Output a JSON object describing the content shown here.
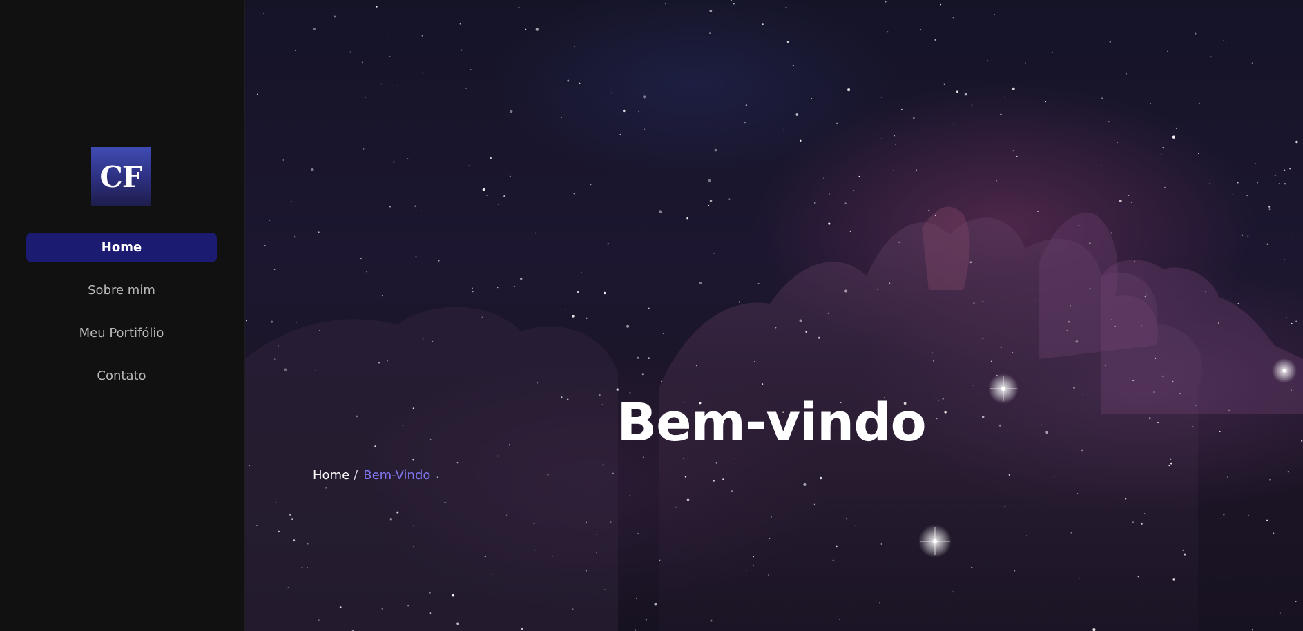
{
  "logo": {
    "text": "CF"
  },
  "sidebar": {
    "nav": [
      {
        "label": "Home",
        "active": true
      },
      {
        "label": "Sobre mim",
        "active": false
      },
      {
        "label": "Meu Portifólio",
        "active": false
      },
      {
        "label": "Contato",
        "active": false
      }
    ]
  },
  "hero": {
    "title": "Bem-vindo",
    "breadcrumb": {
      "home": "Home",
      "separator": "/",
      "current": "Bem-Vindo"
    }
  },
  "colors": {
    "sidebar_bg": "#111111",
    "active_nav_bg": "#1b1b72",
    "breadcrumb_current": "#7f76f0",
    "logo_gradient_top": "#3f4cb3",
    "logo_gradient_bottom": "#1e1d4b"
  }
}
